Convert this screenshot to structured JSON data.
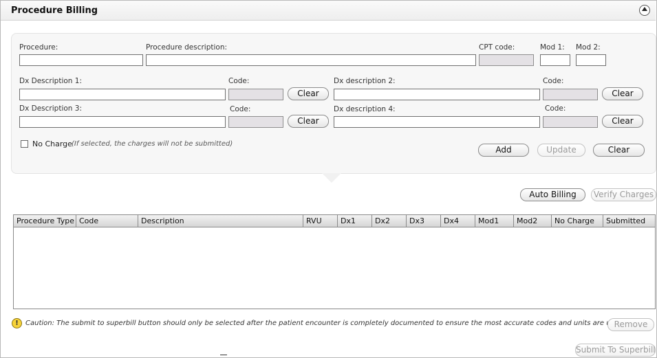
{
  "panel": {
    "title": "Procedure Billing"
  },
  "form": {
    "procedure_label": "Procedure:",
    "procedure_value": "",
    "procedure_description_label": "Procedure description:",
    "procedure_description_value": "",
    "cpt_code_label": "CPT code:",
    "cpt_code_value": "",
    "mod1_label": "Mod 1:",
    "mod1_value": "",
    "mod2_label": "Mod 2:",
    "mod2_value": "",
    "dx1_label": "Dx Description 1:",
    "dx1_value": "",
    "dx1_code_label": "Code:",
    "dx1_code_value": "",
    "dx2_label": "Dx description 2:",
    "dx2_value": "",
    "dx2_code_label": "Code:",
    "dx2_code_value": "",
    "dx3_label": "Dx Description 3:",
    "dx3_value": "",
    "dx3_code_label": "Code:",
    "dx3_code_value": "",
    "dx4_label": "Dx description 4:",
    "dx4_value": "",
    "dx4_code_label": "Code:",
    "dx4_code_value": "",
    "clear_label": "Clear",
    "no_charge_label": "No Charge",
    "no_charge_hint": "(If selected, the charges will not be submitted)",
    "no_charge_checked": false,
    "add_label": "Add",
    "update_label": "Update",
    "form_clear_label": "Clear"
  },
  "actions": {
    "auto_billing_label": "Auto Billing",
    "verify_charges_label": "Verify Charges"
  },
  "table": {
    "columns": [
      "Procedure Type",
      "Code",
      "Description",
      "RVU",
      "Dx1",
      "Dx2",
      "Dx3",
      "Dx4",
      "Mod1",
      "Mod2",
      "No Charge",
      "Submitted"
    ],
    "rows": []
  },
  "footer": {
    "caution_text": "Caution: The submit to superbill button should only be selected after the patient encounter is completely documented to ensure the most accurate codes and units are uploaded.",
    "remove_label": "Remove",
    "submit_label": "Submit To Superbill"
  },
  "icons": {
    "collapse": "chevron-up-circle-icon",
    "caution": "warning-icon"
  },
  "colors": {
    "readonly_field": "#e4e1e5",
    "caution_yellow": "#f7d33a",
    "panel_background": "#f7f7f7"
  }
}
